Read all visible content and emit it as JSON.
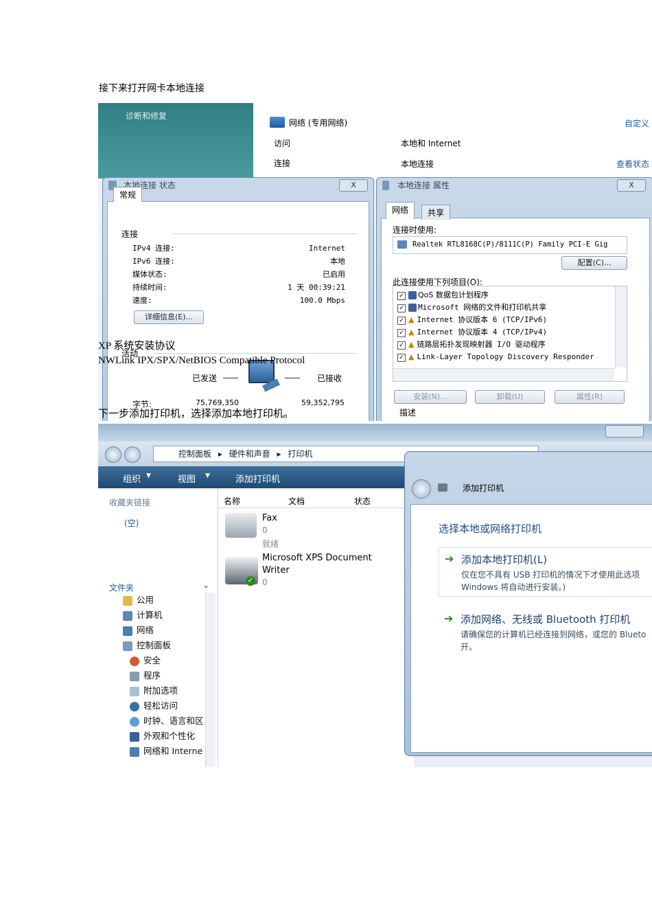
{
  "doc": {
    "heading_1": "接下来打开网卡本地连接",
    "overlay_1": "XP 系统安装协议",
    "overlay_2": "NWLink IPX/SPX/NetBIOS Compatible Protocol",
    "overlay_3": "下一步添加打印机，选择添加本地打印机。"
  },
  "shot1": {
    "sidebar_link": "诊断和修复",
    "network_name": "网络 (专用网络)",
    "customize": "自定义",
    "access_label": "访问",
    "access_value": "本地和 Internet",
    "connection_label": "连接",
    "connection_value": "本地连接",
    "view_status": "查看状态",
    "status_window": {
      "title": "本地连接 状态",
      "close": "X",
      "tab": "常规",
      "group_connection": "连接",
      "rows": [
        {
          "label": "IPv4 连接:",
          "value": "Internet"
        },
        {
          "label": "IPv6 连接:",
          "value": "本地"
        },
        {
          "label": "媒体状态:",
          "value": "已启用"
        },
        {
          "label": "持续时间:",
          "value": "1 天 00:39:21"
        },
        {
          "label": "速度:",
          "value": "100.0 Mbps"
        }
      ],
      "details_button": "详细信息(E)...",
      "group_activity": "活动",
      "sent_label": "已发送",
      "received_label": "已接收",
      "bytes_label": "字节:",
      "bytes_sent": "75,769,350",
      "bytes_received": "59,352,795"
    },
    "props_window": {
      "title": "本地连接 属性",
      "close": "X",
      "tab_network": "网络",
      "tab_share": "共享",
      "connect_using_label": "连接时使用:",
      "adapter": "Realtek RTL8168C(P)/8111C(P) Family PCI-E Gig",
      "configure_button": "配置(C)...",
      "items_label": "此连接使用下列项目(O):",
      "items": [
        "QoS 数据包计划程序",
        "Microsoft 网络的文件和打印机共享",
        "Internet 协议版本 6 (TCP/IPv6)",
        "Internet 协议版本 4 (TCP/IPv4)",
        "链路层拓扑发现映射器 I/O 驱动程序",
        "Link-Layer Topology Discovery Responder"
      ],
      "install_button": "安装(N)...",
      "uninstall_button": "卸载(U)",
      "properties_button": "属性(R)",
      "description_label": "描述"
    }
  },
  "shot2": {
    "breadcrumb": [
      "控制面板",
      "硬件和声音",
      "打印机"
    ],
    "toolbar": {
      "organize": "组织",
      "views": "视图",
      "add_printer": "添加打印机"
    },
    "favorites_label": "收藏夹链接",
    "favorites_empty": "(空)",
    "folders_label": "文件夹",
    "tree": [
      "公用",
      "计算机",
      "网络",
      "控制面板",
      "安全",
      "程序",
      "附加选项",
      "轻松访问",
      "时钟、语言和区",
      "外观和个性化",
      "网络和 Interne"
    ],
    "columns": [
      "名称",
      "文档",
      "状态"
    ],
    "printers": [
      {
        "name": "Fax",
        "docs": "0",
        "status": "就绪"
      },
      {
        "name_line1": "Microsoft XPS Document",
        "name_line2": "Writer",
        "docs": "0"
      }
    ],
    "dialog": {
      "title": "添加打印机",
      "heading": "选择本地或网络打印机",
      "option1_title": "添加本地打印机(L)",
      "option1_desc1": "仅在您不具有 USB 打印机的情况下才使用此选项",
      "option1_desc2": "Windows 将自动进行安装。)",
      "option2_title": "添加网络、无线或 Bluetooth 打印机",
      "option2_desc1": "请确保您的计算机已经连接到网络，或您的 Blueto",
      "option2_desc2": "开。"
    }
  },
  "colors": {
    "accent_blue": "#1f5a9a",
    "teal_sidebar": "#3a8a8f",
    "green_arrow": "#2a8a22"
  }
}
